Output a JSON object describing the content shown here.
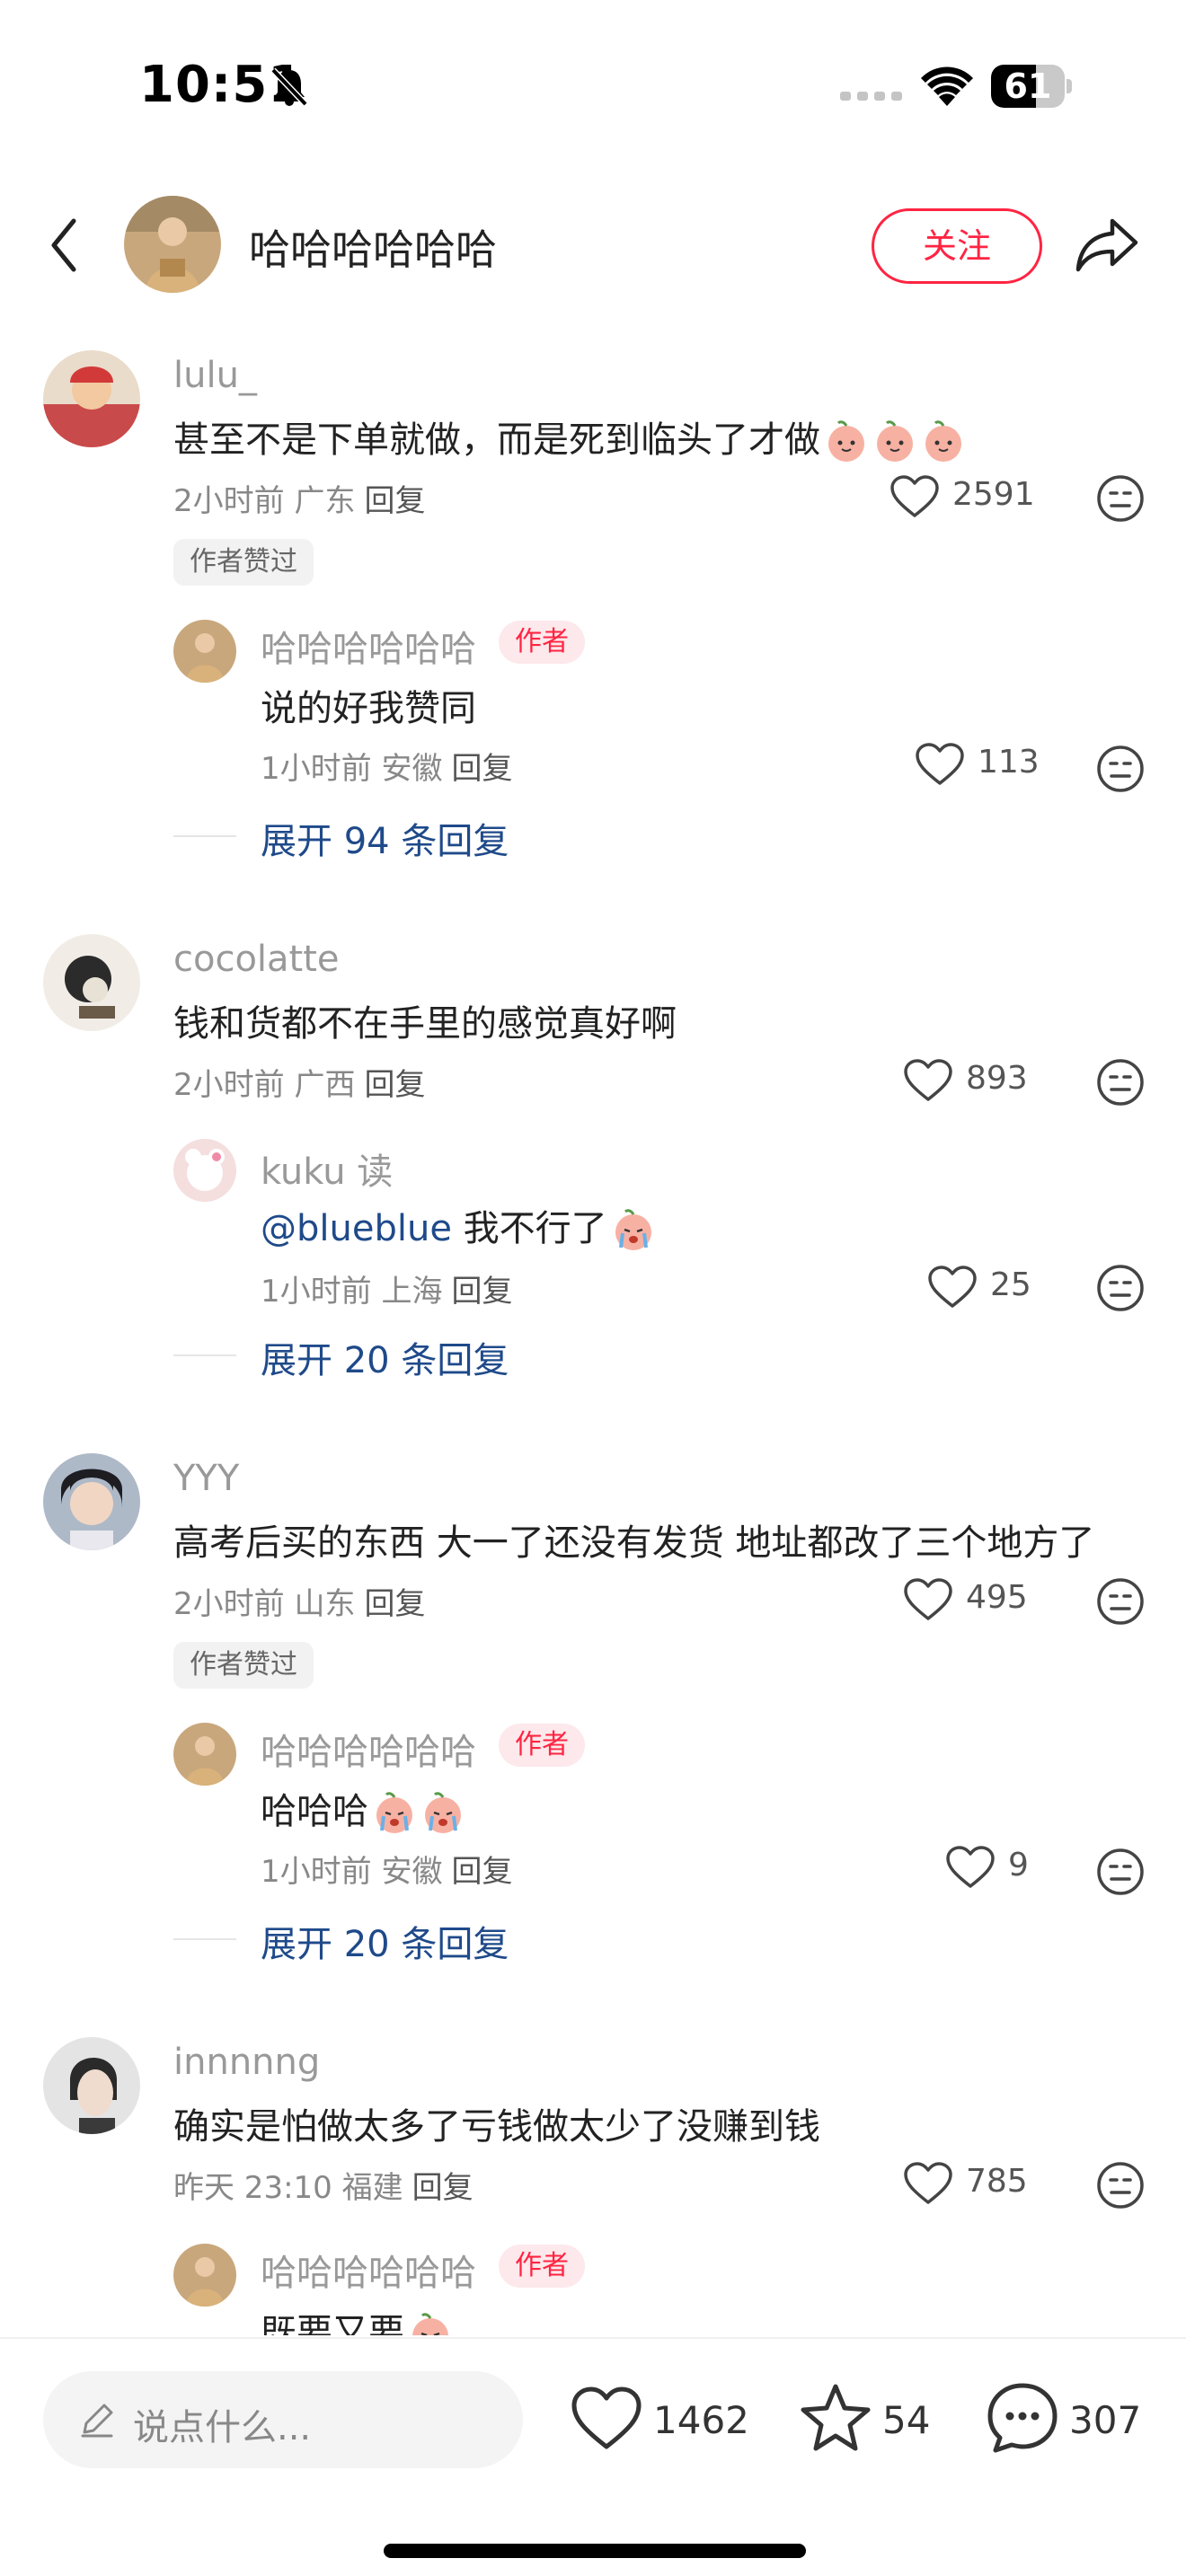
{
  "status_bar": {
    "time": "10:51",
    "battery": "61",
    "battery_level": 0.61
  },
  "header": {
    "author_name": "哈哈哈哈哈哈",
    "follow_label": "关注"
  },
  "comments": [
    {
      "username": "lulu_",
      "text": "甚至不是下单就做，而是死到临头了才做",
      "emoji_count": 3,
      "emoji_icon": "peach-face-emoji",
      "time_location": "2小时前 广东",
      "reply_label": "回复",
      "likes": "2591",
      "badge": "作者赞过",
      "reply": {
        "username": "哈哈哈哈哈哈",
        "tag": "作者",
        "text": "说的好我赞同",
        "time_location": "1小时前 安徽",
        "reply_label": "回复",
        "likes": "113"
      },
      "expand_label": "展开 94 条回复"
    },
    {
      "username": "cocolatte",
      "text": "钱和货都不在手里的感觉真好啊",
      "time_location": "2小时前 广西",
      "reply_label": "回复",
      "likes": "893",
      "reply": {
        "username": "kuku 读",
        "mention": "@blueblue",
        "text": "我不行了",
        "emoji_icon": "crying-peach-emoji",
        "time_location": "1小时前 上海",
        "reply_label": "回复",
        "likes": "25"
      },
      "expand_label": "展开 20 条回复"
    },
    {
      "username": "YYY",
      "text": "高考后买的东西 大一了还没有发货 地址都改了三个地方了",
      "time_location": "2小时前 山东",
      "reply_label": "回复",
      "likes": "495",
      "badge": "作者赞过",
      "reply": {
        "username": "哈哈哈哈哈哈",
        "tag": "作者",
        "text": "哈哈哈",
        "emoji_icon": "crying-peach-emoji",
        "time_location": "1小时前 安徽",
        "reply_label": "回复",
        "likes": "9"
      },
      "expand_label": "展开 20 条回复"
    },
    {
      "username": "innnnng",
      "text": "确实是怕做太多了亏钱做太少了没赚到钱",
      "time_location": "昨天 23:10 福建",
      "reply_label": "回复",
      "likes": "785",
      "reply": {
        "username": "哈哈哈哈哈哈",
        "tag": "作者",
        "text": "既要又要",
        "emoji_icon": "crying-peach-emoji"
      }
    }
  ],
  "bottom_bar": {
    "input_placeholder": "说点什么...",
    "likes": "1462",
    "favorites": "54",
    "comments": "307"
  },
  "colors": {
    "accent": "#ff2442",
    "link": "#1f4a8a",
    "muted": "#999999",
    "text": "#222222"
  }
}
